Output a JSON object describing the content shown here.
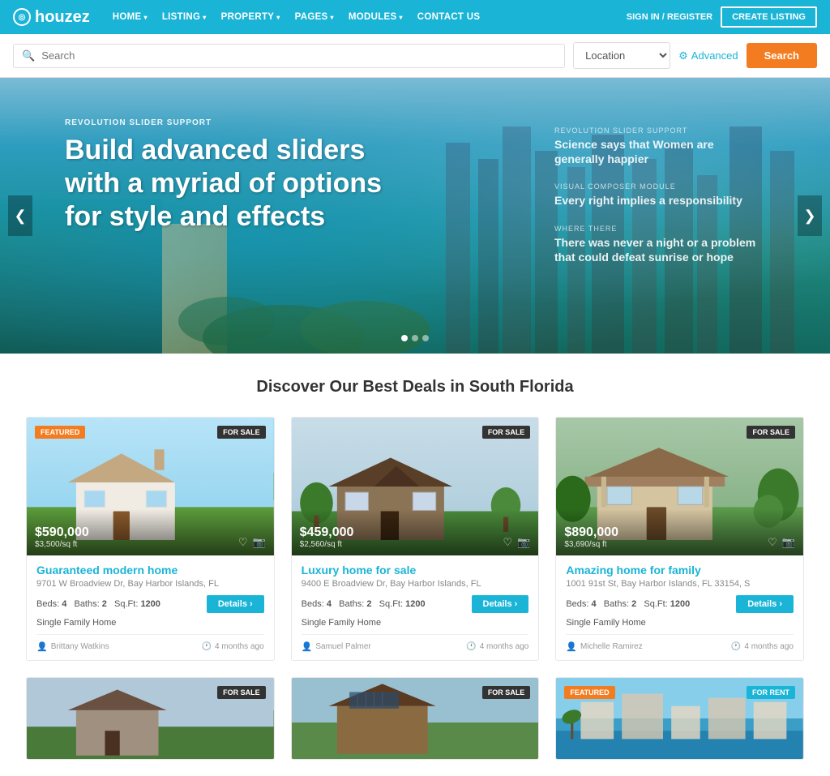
{
  "nav": {
    "logo_text": "houzez",
    "items": [
      {
        "label": "HOME",
        "has_dropdown": true
      },
      {
        "label": "LISTING",
        "has_dropdown": true
      },
      {
        "label": "PROPERTY",
        "has_dropdown": true
      },
      {
        "label": "PAGES",
        "has_dropdown": true
      },
      {
        "label": "MODULES",
        "has_dropdown": true
      },
      {
        "label": "CONTACT US",
        "has_dropdown": false
      }
    ],
    "sign_in": "SIGN IN / REGISTER",
    "create_listing": "CREATE LISTING"
  },
  "search": {
    "placeholder": "Search",
    "location_placeholder": "Location",
    "advanced_label": "Advanced",
    "search_btn": "Search"
  },
  "hero": {
    "label": "REVOLUTION SLIDER SUPPORT",
    "title": "Build advanced sliders with a myriad of options for style and effects",
    "side_items": [
      {
        "label": "REVOLUTION SLIDER SUPPORT",
        "text": "Science says that Women are generally happier"
      },
      {
        "label": "VISUAL COMPOSER MODULE",
        "text": "Every right implies a responsibility"
      },
      {
        "label": "WHERE THERE",
        "text": "There was never a night or a problem that could defeat sunrise or hope"
      }
    ]
  },
  "discover": {
    "title": "Discover Our Best Deals in South Florida"
  },
  "listings": [
    {
      "id": 1,
      "featured": true,
      "badge": "FOR SALE",
      "price": "$590,000",
      "price_sqft": "$3,500/sq ft",
      "title": "Guaranteed modern home",
      "address": "9701 W Broadview Dr, Bay Harbor Islands, FL",
      "beds": 4,
      "baths": 2,
      "sqft": 1200,
      "type": "Single Family Home",
      "agent": "Brittany Watkins",
      "time": "4 months ago",
      "house_class": "house-1"
    },
    {
      "id": 2,
      "featured": false,
      "badge": "FOR SALE",
      "price": "$459,000",
      "price_sqft": "$2,560/sq ft",
      "title": "Luxury home for sale",
      "address": "9400 E Broadview Dr, Bay Harbor Islands, FL",
      "beds": 4,
      "baths": 2,
      "sqft": 1200,
      "type": "Single Family Home",
      "agent": "Samuel Palmer",
      "time": "4 months ago",
      "house_class": "house-2"
    },
    {
      "id": 3,
      "featured": false,
      "badge": "FOR SALE",
      "price": "$890,000",
      "price_sqft": "$3,690/sq ft",
      "title": "Amazing home for family",
      "address": "1001 91st St, Bay Harbor Islands, FL 33154, S",
      "beds": 4,
      "baths": 2,
      "sqft": 1200,
      "type": "Single Family Home",
      "agent": "Michelle Ramirez",
      "time": "4 months ago",
      "house_class": "house-3"
    }
  ],
  "listings_bottom": [
    {
      "badge": "FOR SALE",
      "house_class": "house-4",
      "featured": false,
      "badge_type": "sale"
    },
    {
      "badge": "FOR SALE",
      "house_class": "house-5",
      "featured": false,
      "badge_type": "sale"
    },
    {
      "badge": "FOR RENT",
      "house_class": "house-6",
      "featured": true,
      "badge_type": "rent"
    }
  ],
  "icons": {
    "search": "🔍",
    "gear": "⚙",
    "heart": "♡",
    "camera": "📷",
    "user": "👤",
    "clock": "🕐",
    "chevron_right": "›",
    "chevron_down": "▾",
    "arrow_left": "❮",
    "arrow_right": "❯",
    "target": "◎"
  },
  "colors": {
    "primary": "#1ab4d7",
    "orange": "#f47c20",
    "dark": "#333333",
    "light_bg": "#f5f5f5"
  }
}
